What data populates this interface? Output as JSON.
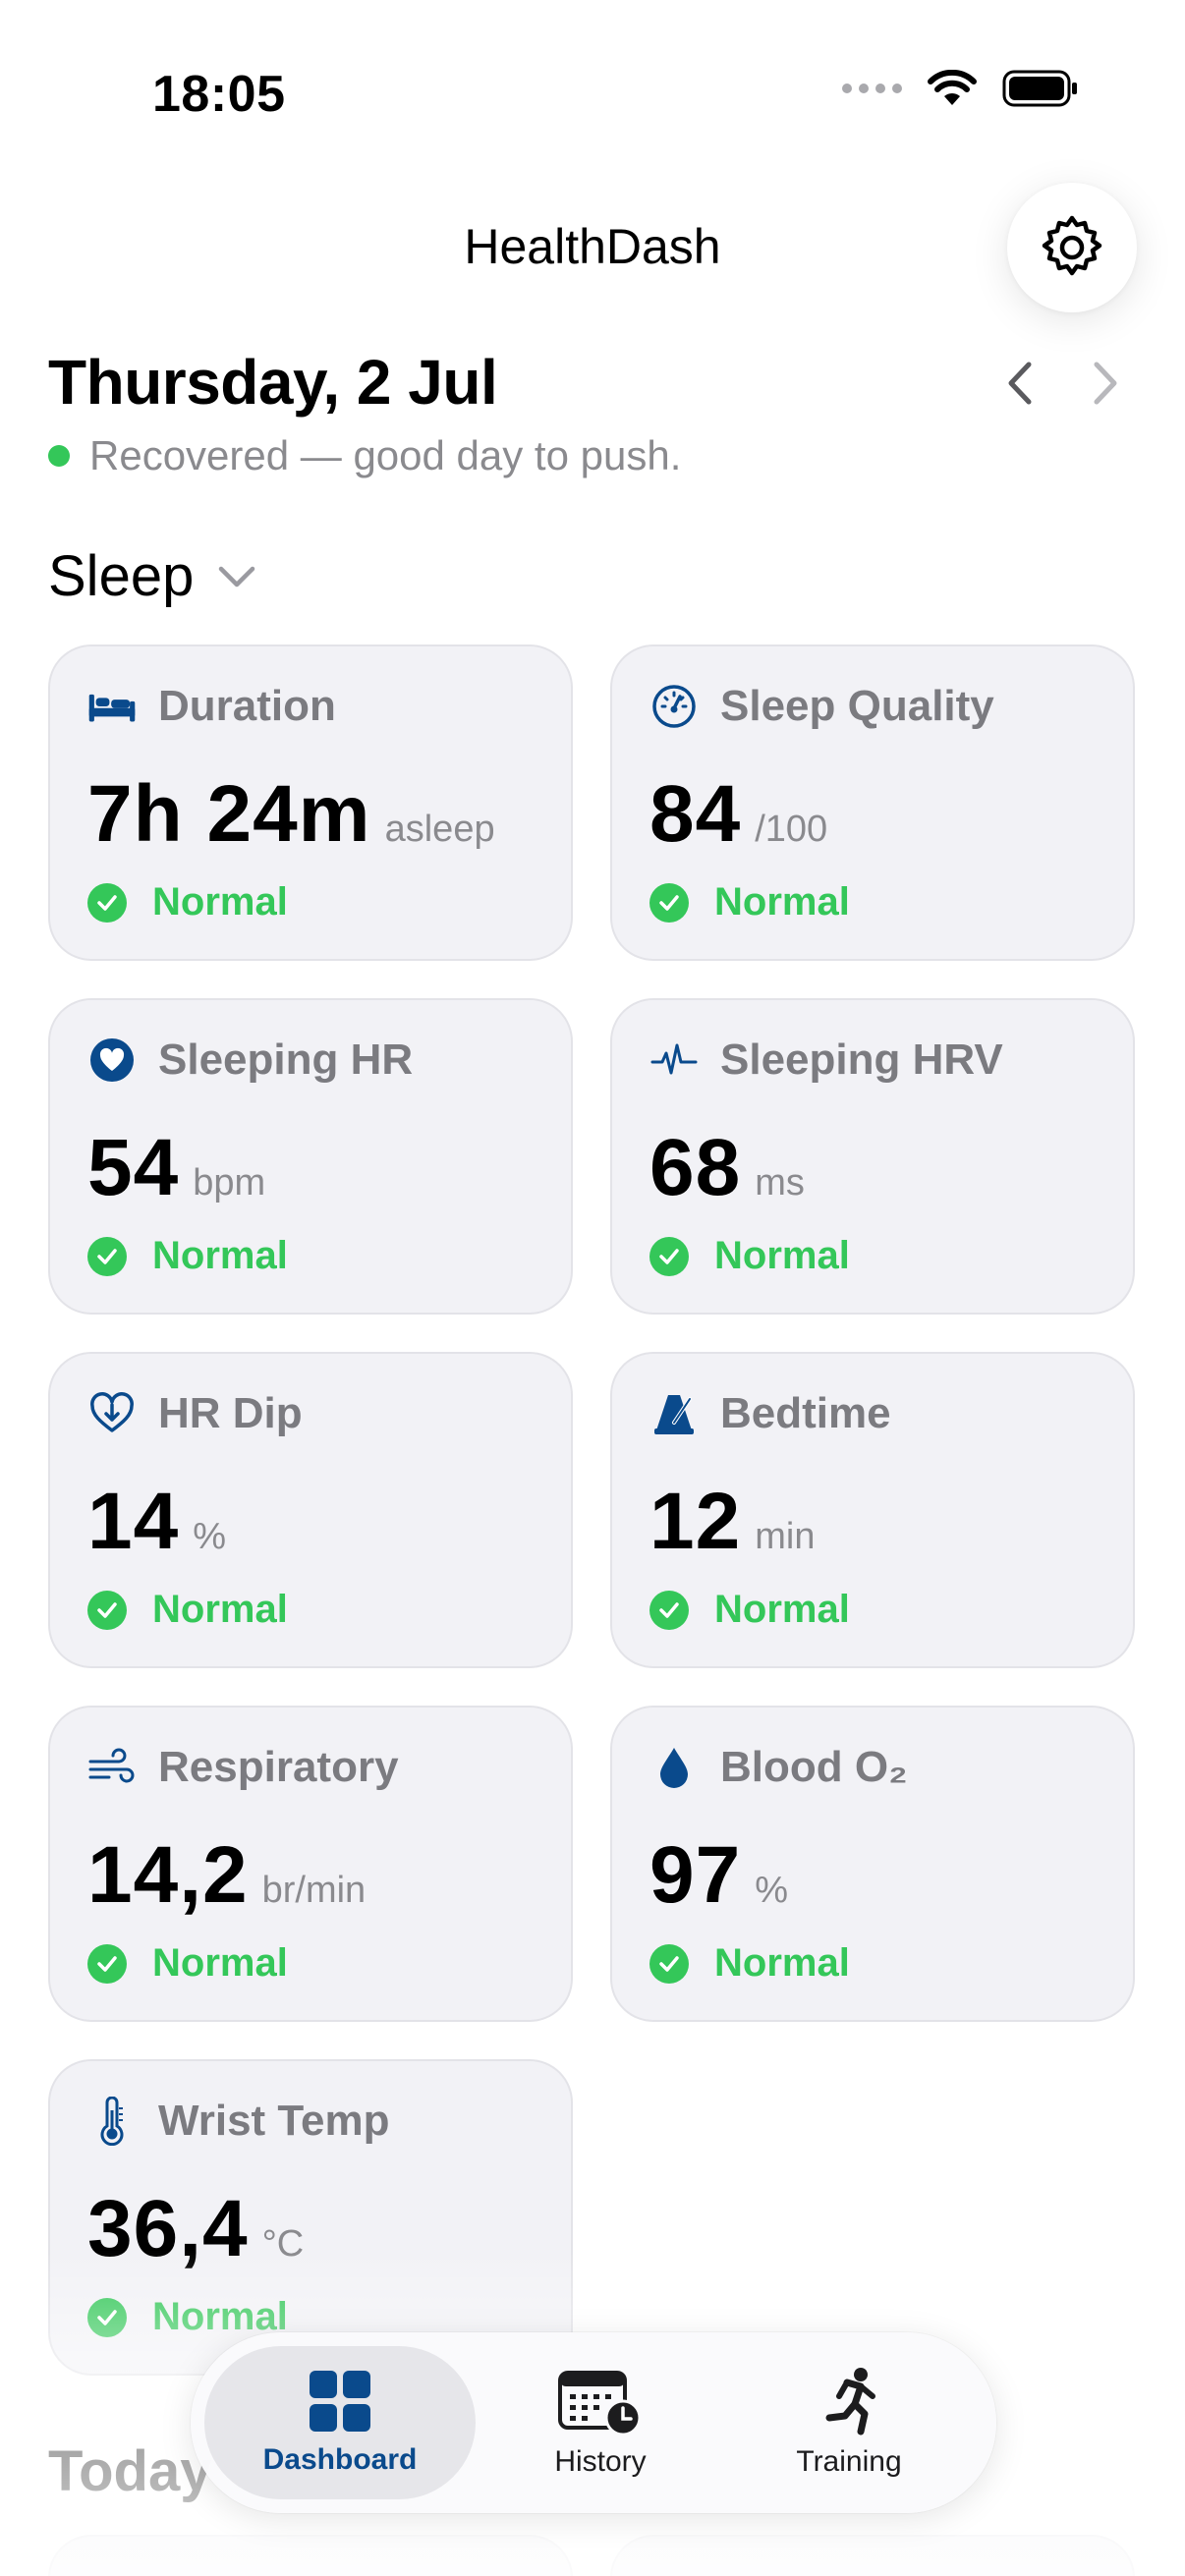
{
  "status_bar": {
    "time": "18:05"
  },
  "header": {
    "title": "HealthDash",
    "settings_icon": "gear-icon"
  },
  "date": {
    "title": "Thursday, 2 Jul",
    "recovery_text": "Recovered — good day to push.",
    "recovery_color": "#34c759"
  },
  "section": {
    "title": "Sleep"
  },
  "cards": [
    {
      "label": "Duration",
      "value": "7h 24m",
      "unit": "asleep",
      "status": "Normal",
      "icon": "bed-icon"
    },
    {
      "label": "Sleep Quality",
      "value": "84",
      "unit": "/100",
      "status": "Normal",
      "icon": "gauge-icon"
    },
    {
      "label": "Sleeping HR",
      "value": "54",
      "unit": "bpm",
      "status": "Normal",
      "icon": "heart-icon"
    },
    {
      "label": "Sleeping HRV",
      "value": "68",
      "unit": "ms",
      "status": "Normal",
      "icon": "waveform-icon"
    },
    {
      "label": "HR Dip",
      "value": "14",
      "unit": "%",
      "status": "Normal",
      "icon": "heart-down-icon"
    },
    {
      "label": "Bedtime",
      "value": "12",
      "unit": "min",
      "status": "Normal",
      "icon": "metronome-icon"
    },
    {
      "label": "Respiratory",
      "value": "14,2",
      "unit": "br/min",
      "status": "Normal",
      "icon": "wind-icon"
    },
    {
      "label": "Blood O₂",
      "value": "97",
      "unit": "%",
      "status": "Normal",
      "icon": "drop-icon"
    },
    {
      "label": "Wrist Temp",
      "value": "36,4",
      "unit": "°C",
      "status": "Normal",
      "icon": "thermometer-icon"
    }
  ],
  "next_section": {
    "title": "Today"
  },
  "tabbar": {
    "tabs": [
      {
        "label": "Dashboard",
        "icon": "grid-icon",
        "active": true
      },
      {
        "label": "History",
        "icon": "calendar-clock-icon",
        "active": false
      },
      {
        "label": "Training",
        "icon": "running-figure-icon",
        "active": false
      }
    ]
  },
  "colors": {
    "accent": "#0a4a8c",
    "status_green": "#34c759",
    "card_bg": "#f2f2f6",
    "muted_text": "#8a8a8e"
  }
}
